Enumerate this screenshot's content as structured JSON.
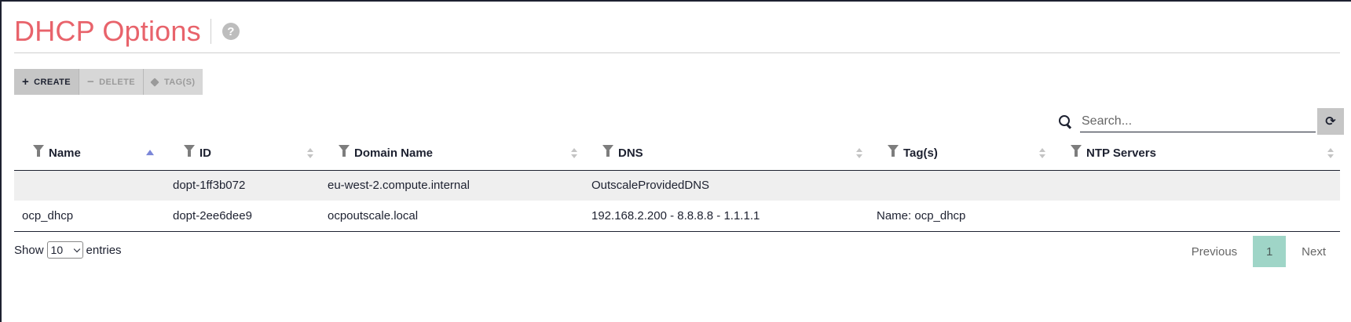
{
  "header": {
    "title": "DHCP Options",
    "help_icon": "question-circle-icon"
  },
  "toolbar": {
    "create_label": "CREATE",
    "delete_label": "DELETE",
    "tags_label": "TAG(S)",
    "create_icon": "plus-icon",
    "delete_icon": "minus-icon",
    "tags_icon": "tag-icon"
  },
  "search": {
    "placeholder": "Search...",
    "value": ""
  },
  "table": {
    "columns": [
      "Name",
      "ID",
      "Domain Name",
      "DNS",
      "Tag(s)",
      "NTP Servers"
    ],
    "sorted_column": "Name",
    "sort_direction": "asc",
    "rows": [
      {
        "name": "",
        "id": "dopt-1ff3b072",
        "domain_name": "eu-west-2.compute.internal",
        "dns": "OutscaleProvidedDNS",
        "tags": "",
        "ntp": ""
      },
      {
        "name": "ocp_dhcp",
        "id": "dopt-2ee6dee9",
        "domain_name": "ocpoutscale.local",
        "dns": "192.168.2.200 - 8.8.8.8 - 1.1.1.1",
        "tags": "Name: ocp_dhcp",
        "ntp": ""
      }
    ]
  },
  "footer": {
    "show_label": "Show",
    "entries_value": "10",
    "entries_label": "entries",
    "previous_label": "Previous",
    "current_page": "1",
    "next_label": "Next"
  },
  "colors": {
    "title": "#e8636b",
    "active_page": "#9fd5c7",
    "sort_active": "#7b86d8",
    "row_stripe": "#efefef"
  }
}
